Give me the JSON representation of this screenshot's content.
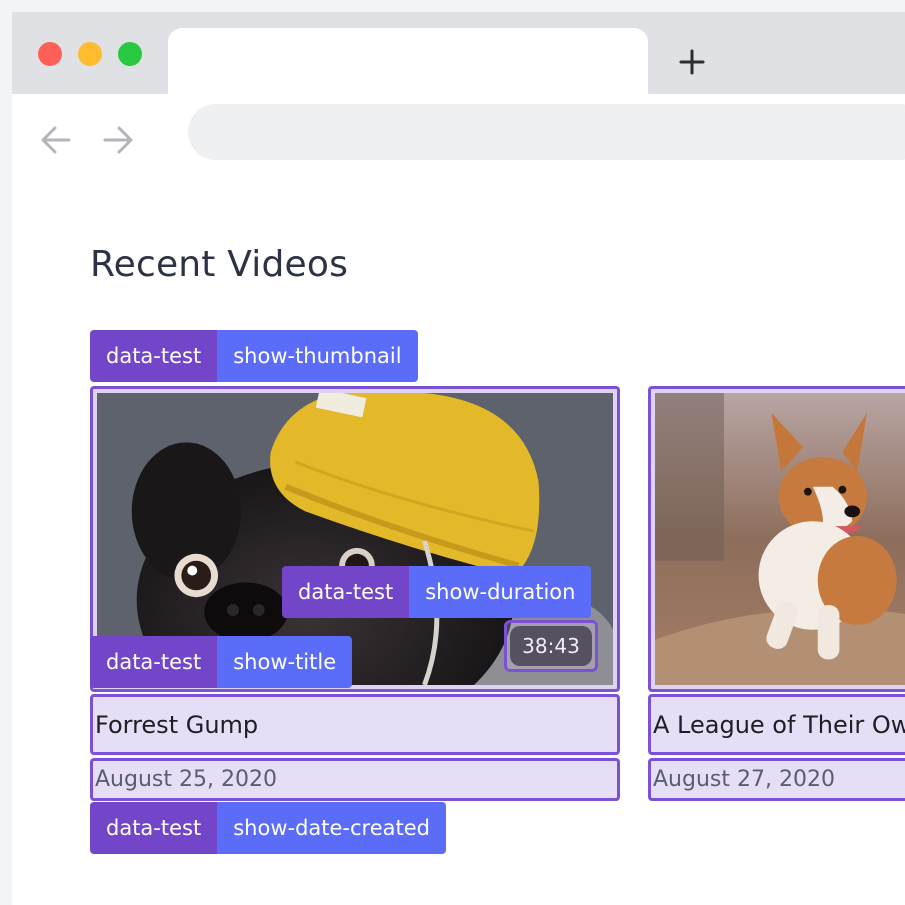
{
  "browser": {
    "window_controls": [
      "close",
      "minimize",
      "maximize"
    ],
    "new_tab_icon": "plus-icon",
    "back_icon": "arrow-left-icon",
    "forward_icon": "arrow-right-icon",
    "url": ""
  },
  "page": {
    "title": "Recent Videos"
  },
  "tags": {
    "key": "data-test",
    "thumbnail": "show-thumbnail",
    "duration": "show-duration",
    "title": "show-title",
    "date_created": "show-date-created"
  },
  "videos": [
    {
      "title": "Forrest Gump",
      "date": "August 25, 2020",
      "duration": "38:43",
      "thumbnail": "pug in yellow beanie"
    },
    {
      "title": "A League of Their Own",
      "date": "August 27, 2020",
      "thumbnail": "corgi running on path"
    }
  ],
  "colors": {
    "tag_key": "#7346c9",
    "tag_value": "#5b6cf8",
    "outline": "#7b52d6",
    "highlight": "#e6def6"
  }
}
